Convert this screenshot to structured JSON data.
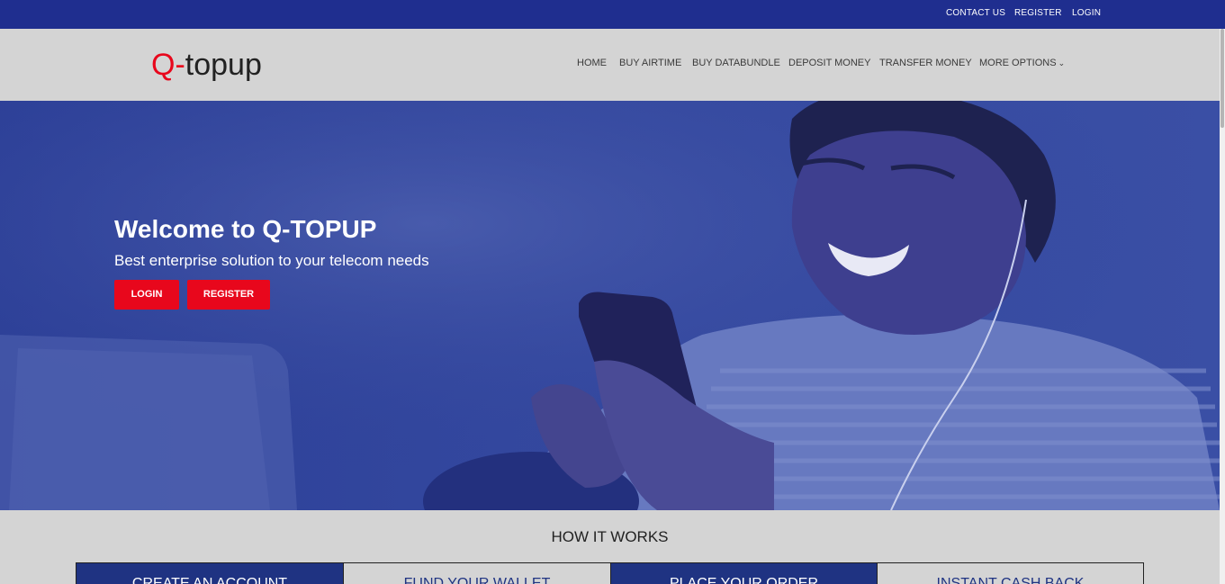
{
  "topbar": {
    "contact": "CONTACT US",
    "register": "REGISTER",
    "login": "LOGIN"
  },
  "logo": {
    "q": "Q-",
    "rest": "topup"
  },
  "nav": {
    "home": "HOME",
    "buy_airtime": "BUY AIRTIME",
    "buy_databundle": "BUY DATABUNDLE",
    "deposit_money": "DEPOSIT MONEY",
    "transfer_money": "TRANSFER MONEY",
    "more_options": "MORE OPTIONS"
  },
  "hero": {
    "title": "Welcome to Q-TOPUP",
    "subtitle": "Best enterprise solution to your telecom needs",
    "login_label": "LOGIN",
    "register_label": "REGISTER"
  },
  "how_it_works": {
    "title": "HOW IT WORKS",
    "cards": [
      "CREATE AN ACCOUNT",
      "FUND YOUR WALLET",
      "PLACE YOUR ORDER",
      "INSTANT CASH BACK"
    ]
  },
  "colors": {
    "topbar": "#1f2e8f",
    "accent_red": "#e8071c",
    "hero_overlay": "#33479e"
  }
}
